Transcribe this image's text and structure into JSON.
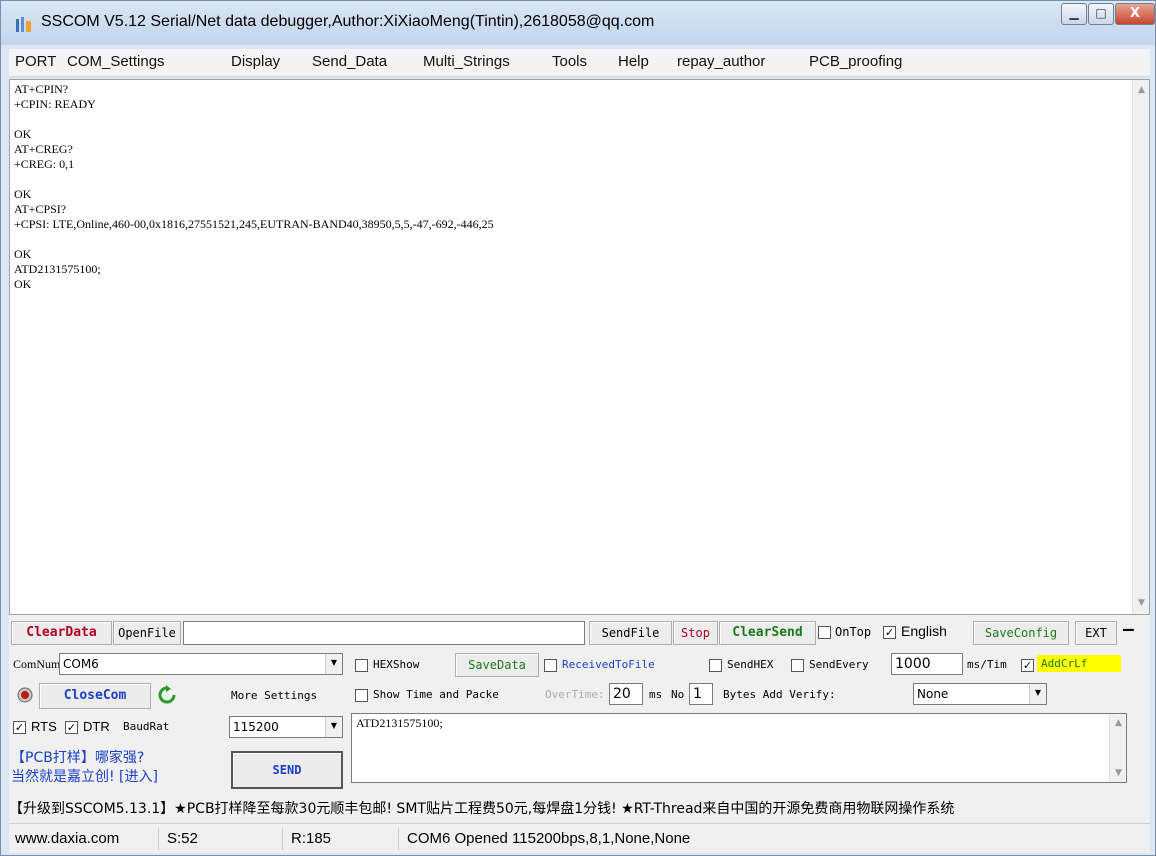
{
  "window": {
    "title": "SSCOM V5.12 Serial/Net data debugger,Author:XiXiaoMeng(Tintin),2618058@qq.com",
    "min_label": "▁",
    "max_label": "□",
    "close_label": "X"
  },
  "menu": [
    "PORT",
    "COM_Settings",
    "Display",
    "Send_Data",
    "Multi_Strings",
    "Tools",
    "Help",
    "repay_author",
    "PCB_proofing"
  ],
  "receive": {
    "text": "AT+CPIN?\n+CPIN: READY\n\nOK\nAT+CREG?\n+CREG: 0,1\n\nOK\nAT+CPSI?\n+CPSI: LTE,Online,460-00,0x1816,27551521,245,EUTRAN-BAND40,38950,5,5,-47,-692,-446,25\n\nOK\nATD2131575100;\nOK"
  },
  "toolbar": {
    "clear_data": "ClearData",
    "open_file": "OpenFile",
    "file_path": "",
    "send_file": "SendFile",
    "stop": "Stop",
    "clear_send": "ClearSend",
    "ontop": "OnTop",
    "english": "English",
    "save_config": "SaveConfig",
    "ext": "EXT",
    "dash": "—"
  },
  "port": {
    "com_num_label": "ComNum",
    "com_num_value": "COM6",
    "close_com": "CloseCom",
    "more_settings": "More Settings",
    "rts": "RTS",
    "dtr": "DTR",
    "baud_label": "BaudRat",
    "baud_value": "115200"
  },
  "options": {
    "hexshow": "HEXShow",
    "save_data": "SaveData",
    "received_to_file": "ReceivedToFile",
    "send_hex": "SendHEX",
    "send_every": "SendEvery",
    "send_every_value": "1000",
    "ms_tim": "ms/Tim",
    "add_crlf": "AddCrLf",
    "show_time": "Show Time and Packe",
    "overtime": "OverTime:",
    "overtime_value": "20",
    "ms": "ms",
    "no": "No",
    "no_value": "1",
    "bytes_add_verify": "Bytes Add Verify:",
    "verify_value": "None"
  },
  "send": {
    "text": "ATD2131575100;",
    "button": "SEND"
  },
  "ad": {
    "line1": "【PCB打样】哪家强?",
    "line2": "当然就是嘉立创! [进入]"
  },
  "ticker": "【升级到SSCOM5.13.1】★PCB打样降至每款30元顺丰包邮! SMT贴片工程费50元,每焊盘1分钱! ★RT-Thread来自中国的开源免费商用物联网操作系统",
  "status": {
    "site": "www.daxia.com",
    "sent": "S:52",
    "received": "R:185",
    "port_state": "COM6 Opened  115200bps,8,1,None,None"
  },
  "colors": {
    "accent_red": "#b00020",
    "accent_green": "#1a7a1a",
    "crlf_highlight": "#ffff00"
  }
}
